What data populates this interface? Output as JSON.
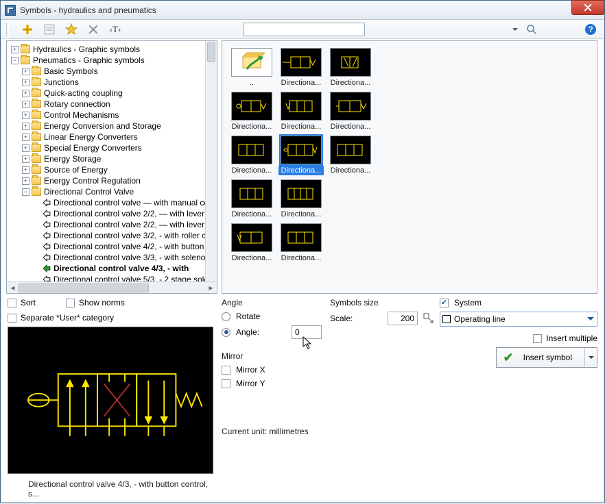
{
  "window": {
    "title": "Symbols - hydraulics and pneumatics"
  },
  "toolbar": {
    "search_placeholder": ""
  },
  "tree": {
    "root1": "Hydraulics - Graphic symbols",
    "root2": "Pneumatics - Graphic symbols",
    "pneu": {
      "basic": "Basic Symbols",
      "junctions": "Junctions",
      "quick": "Quick-acting coupling",
      "rotary": "Rotary connection",
      "control": "Control Mechanisms",
      "energy_conv": "Energy Conversion and Storage",
      "linear": "Linear Energy Converters",
      "special": "Special Energy Converters",
      "storage": "Energy Storage",
      "source": "Source of Energy",
      "regulation": "Energy Control Regulation",
      "dcv": "Directional Control Valve",
      "dcv_items": {
        "manual": "Directional control valve — with manual co",
        "d22a": "Directional control valve 2/2, — with lever",
        "d22b": "Directional control valve 2/2, — with lever",
        "d32": "Directional control valve 3/2, - with roller c",
        "d42": "Directional control valve 4/2, - with button",
        "d33": "Directional control valve 3/3, - with solenoi",
        "d43": "Directional control valve 4/3, - with",
        "d53": "Directional control valve 5/3, - 2 stage sole"
      }
    }
  },
  "left_checks": {
    "sort": "Sort",
    "show_norms": "Show norms",
    "separate": "Separate *User* category"
  },
  "preview": {
    "caption": "Directional control valve 4/3, - with button control, s..."
  },
  "gallery": {
    "up": "..",
    "labels": [
      "Directiona...",
      "Directiona...",
      "Directiona...",
      "Directiona...",
      "Directiona...",
      "Directiona...",
      "Directiona...",
      "Directiona...",
      "Directiona...",
      "Directiona...",
      "Directiona...",
      "Directiona..."
    ]
  },
  "angle": {
    "title": "Angle",
    "rotate": "Rotate",
    "angle_lbl": "Angle:",
    "angle_val": "0"
  },
  "mirror": {
    "title": "Mirror",
    "x": "Mirror X",
    "y": "Mirror Y"
  },
  "size": {
    "title": "Symbols size",
    "scale_lbl": "Scale:",
    "scale_val": "200"
  },
  "system": {
    "chk": "System",
    "value": "Operating line"
  },
  "bottom": {
    "insert_multiple": "Insert multiple",
    "insert_symbol": "Insert symbol",
    "unit": "Current unit: millimetres"
  }
}
